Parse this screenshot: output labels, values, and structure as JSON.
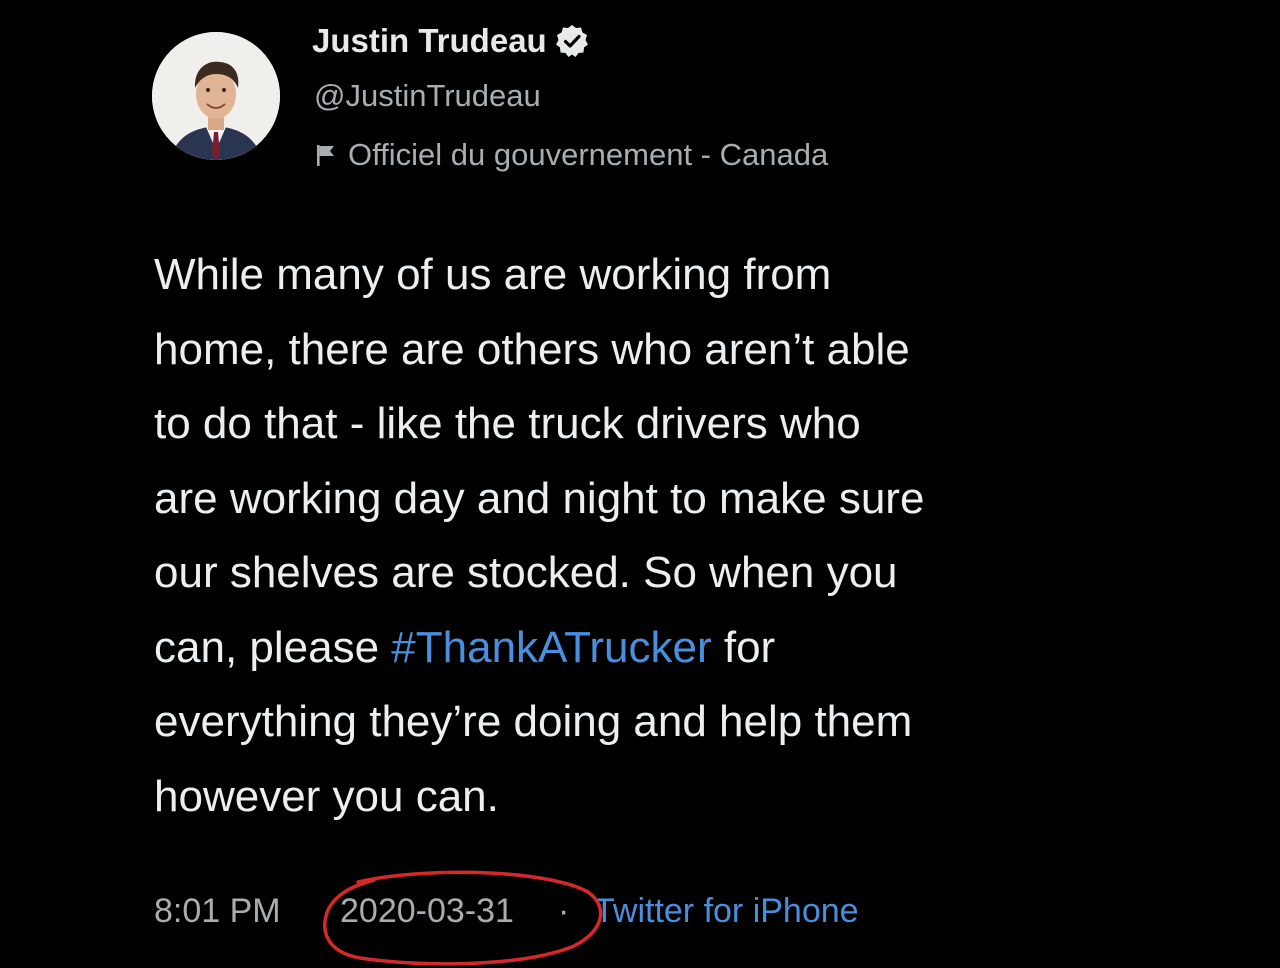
{
  "profile": {
    "display_name": "Justin Trudeau",
    "handle": "@JustinTrudeau",
    "verified_icon": "verified-badge-icon",
    "gov_label": "Officiel du gouvernement - Canada",
    "gov_label_icon": "flag-icon",
    "avatar": "profile-photo"
  },
  "tweet": {
    "lines": [
      "While many of us are working from",
      "home, there are others who aren’t able",
      "to do that - like the truck drivers who",
      "are working day and night to make sure",
      "our shelves are stocked. So when you"
    ],
    "line6_before": "can, please ",
    "hashtag": "#ThankATrucker",
    "line6_after": " for",
    "lines_end": [
      "everything they’re doing and help them",
      "however you can."
    ]
  },
  "meta": {
    "time": "8:01 PM",
    "date": "2020-03-31",
    "separator": "·",
    "source": "Twitter for iPhone"
  },
  "colors": {
    "background": "#000000",
    "text": "#e7e9ea",
    "secondary": "#a8adb2",
    "link": "#4a8fde",
    "annotation": "#d4282b"
  }
}
